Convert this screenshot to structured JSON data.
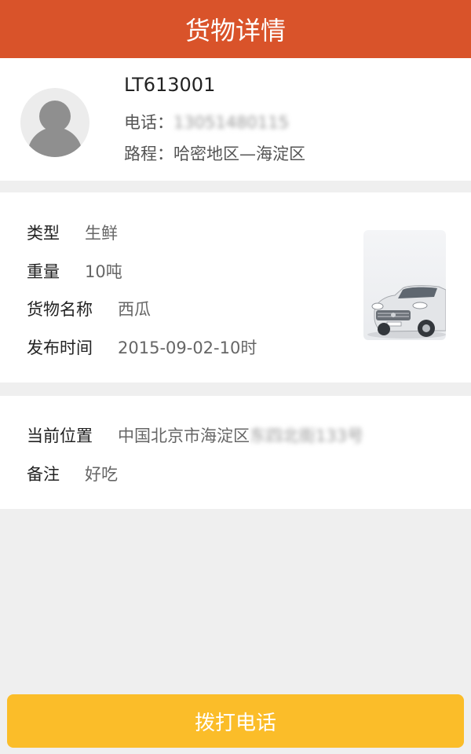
{
  "header": {
    "title": "货物详情"
  },
  "driver": {
    "code": "LT613001",
    "phone_label": "电话：",
    "phone_value": "13051480115",
    "route_label": "路程：",
    "route_value": "哈密地区—海淀区"
  },
  "cargo": {
    "type_label": "类型",
    "type_value": "生鲜",
    "weight_label": "重量",
    "weight_value": "10吨",
    "name_label": "货物名称",
    "name_value": "西瓜",
    "publish_label": "发布时间",
    "publish_value": "2015-09-02-10时"
  },
  "location": {
    "current_label": "当前位置",
    "current_value": "中国北京市海淀区",
    "current_value_blurred": "东四北街133号",
    "note_label": "备注",
    "note_value": "好吃"
  },
  "footer": {
    "call_label": "拨打电话"
  },
  "colors": {
    "header": "#d9532a",
    "button": "#fbbd29",
    "background": "#efefef"
  }
}
